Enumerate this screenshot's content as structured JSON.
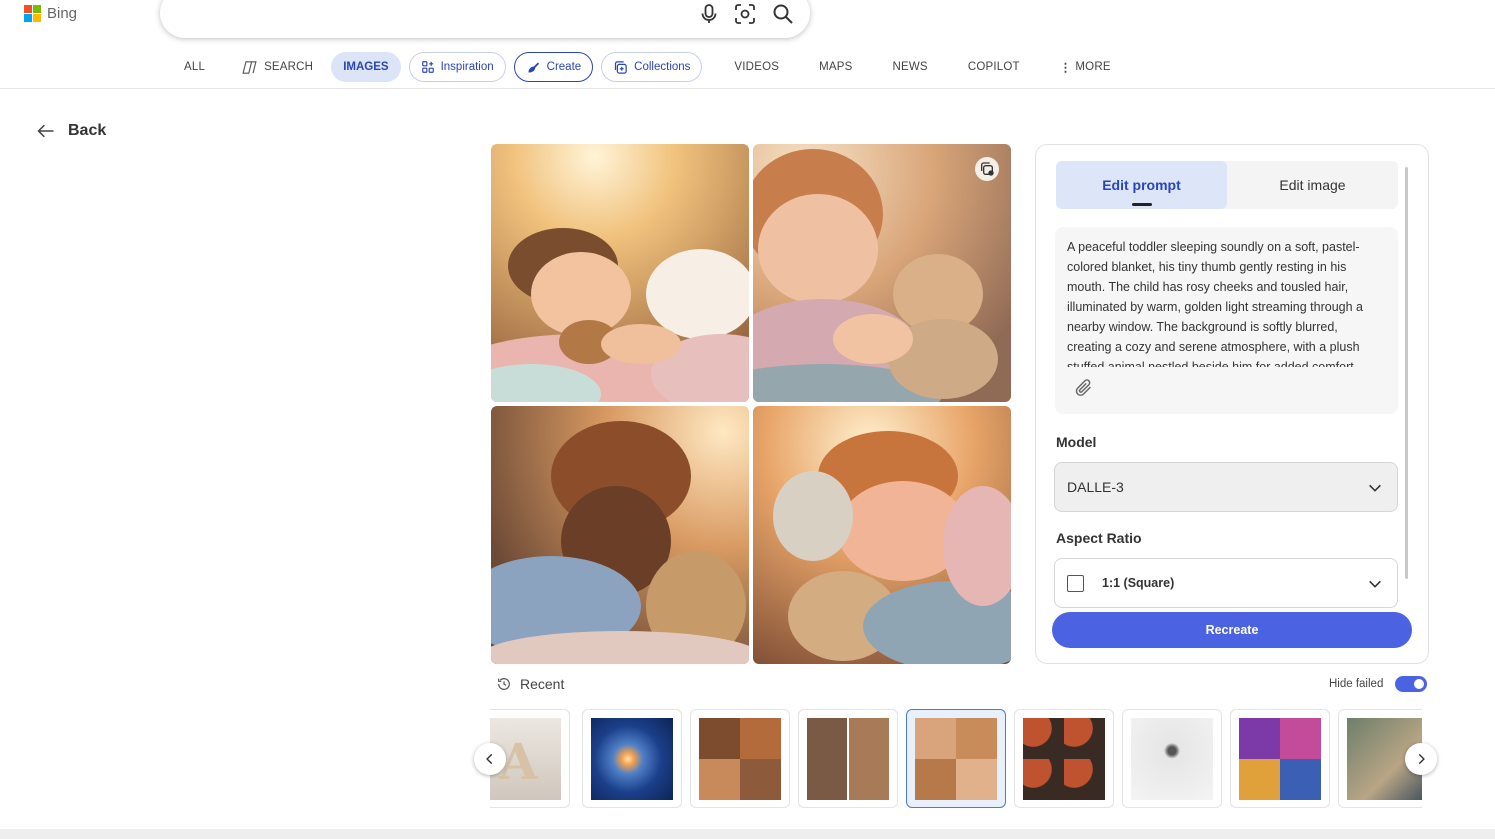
{
  "brand": {
    "name": "Bing"
  },
  "search": {
    "placeholder": ""
  },
  "nav": {
    "all": "ALL",
    "search": "SEARCH",
    "images": "IMAGES",
    "inspiration": "Inspiration",
    "create": "Create",
    "collections": "Collections",
    "videos": "VIDEOS",
    "maps": "MAPS",
    "news": "NEWS",
    "copilot": "COPILOT",
    "more": "MORE"
  },
  "back": {
    "label": "Back"
  },
  "panel": {
    "tab_prompt": "Edit prompt",
    "tab_image": "Edit image",
    "prompt": "A peaceful toddler sleeping soundly on a soft, pastel-colored blanket, his tiny thumb gently resting in his mouth. The child has rosy cheeks and tousled hair, illuminated by warm, golden light streaming through a nearby window. The background is softly blurred, creating a cozy and serene atmosphere, with a plush stuffed animal nestled beside him for added comfort.",
    "model_label": "Model",
    "model_value": "DALLE-3",
    "aspect_label": "Aspect Ratio",
    "aspect_value": "1:1 (Square)",
    "recreate": "Recreate"
  },
  "history": {
    "recent": "Recent",
    "hide_failed": "Hide failed",
    "hide_failed_on": true
  },
  "colors": {
    "accent": "#4b63e3",
    "active_tab_bg": "#dde5f8",
    "link": "#2b45b8"
  }
}
